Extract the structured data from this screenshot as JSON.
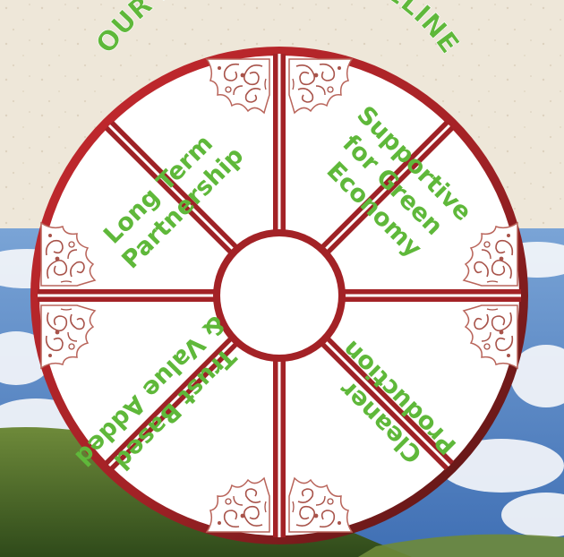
{
  "title": "OUR BUSINESS GUIDELINE",
  "quadrants": {
    "top_left": {
      "lines": [
        "Long Term",
        "Partnership"
      ]
    },
    "top_right": {
      "lines": [
        "Supportive",
        "for Green",
        "Economy"
      ]
    },
    "bottom_right": {
      "lines": [
        "Cleaner",
        "Production"
      ]
    },
    "bottom_left": {
      "lines": [
        "Trust Based",
        "& Value Added"
      ]
    }
  },
  "colors": {
    "text_green": "#5FB83A",
    "ring_red": "#B8262B",
    "ring_dark": "#5A1614",
    "paper": "#EDE6D8",
    "sky": "#5F8EC8",
    "hill": "#4E6B2C",
    "ornament": "#A8534A"
  },
  "icons": {
    "ornament": "ornate-scroll-icon"
  }
}
